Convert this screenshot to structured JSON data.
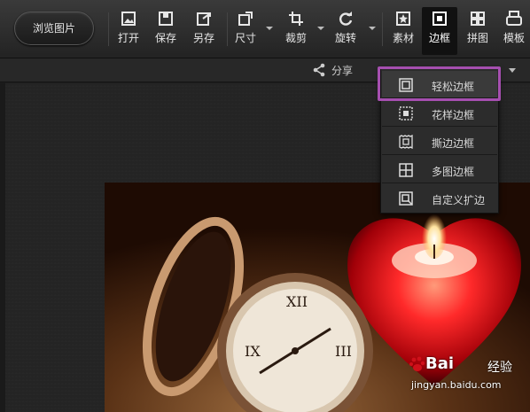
{
  "toolbar": {
    "browse_label": "浏览图片",
    "tools": [
      {
        "id": "open",
        "label": "打开",
        "icon": "open-image-icon"
      },
      {
        "id": "save",
        "label": "保存",
        "icon": "save-icon"
      },
      {
        "id": "save_as",
        "label": "另存",
        "icon": "save-as-icon"
      },
      {
        "id": "size",
        "label": "尺寸",
        "icon": "resize-icon"
      },
      {
        "id": "crop",
        "label": "裁剪",
        "icon": "crop-icon"
      },
      {
        "id": "rotate",
        "label": "旋转",
        "icon": "rotate-icon"
      },
      {
        "id": "material",
        "label": "素材",
        "icon": "star-icon"
      },
      {
        "id": "border",
        "label": "边框",
        "icon": "frame-icon"
      },
      {
        "id": "collage",
        "label": "拼图",
        "icon": "grid-icon"
      },
      {
        "id": "template",
        "label": "模板",
        "icon": "template-icon"
      }
    ]
  },
  "subbar": {
    "share_label": "分享"
  },
  "dropdown": {
    "items": [
      {
        "label": "轻松边框",
        "icon": "simple-frame-icon"
      },
      {
        "label": "花样边框",
        "icon": "pattern-frame-icon"
      },
      {
        "label": "撕边边框",
        "icon": "torn-frame-icon"
      },
      {
        "label": "多图边框",
        "icon": "multi-image-frame-icon"
      },
      {
        "label": "自定义扩边",
        "icon": "custom-extend-icon"
      }
    ]
  },
  "watermark": {
    "brand": "Bai",
    "brand_suffix": "经验",
    "url": "jingyan.baidu.com"
  },
  "colors": {
    "highlight": "#a64fb0",
    "toolbar_bg": "#2e2e2e"
  }
}
